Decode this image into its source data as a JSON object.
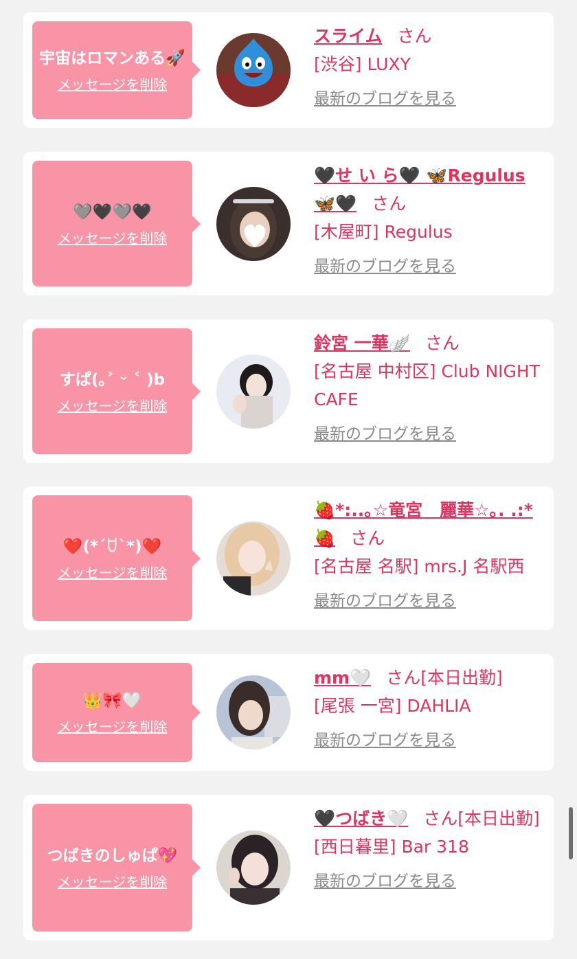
{
  "cards": [
    {
      "message": "宇宙はロマンある🚀",
      "delete_label": "メッセージを削除",
      "name": "スライム",
      "san": "さん",
      "shop": "[渋谷] LUXY",
      "blog_label": "最新のブログを見る"
    },
    {
      "message": "🩶🖤🩶🖤",
      "delete_label": "メッセージを削除",
      "name": "🖤せ い ら🖤 🦋Regulus🦋🖤",
      "san": "さん",
      "shop": "[木屋町] Regulus",
      "blog_label": "最新のブログを見る"
    },
    {
      "message": "すぱ(｡˃ ᵕ ˂ )b",
      "delete_label": "メッセージを削除",
      "name": "鈴宮 一華🪽",
      "san": "さん",
      "shop": "[名古屋 中村区] Club NIGHT CAFE",
      "blog_label": "最新のブログを見る"
    },
    {
      "message": "❤️(*´ꇴ`*)❤️",
      "delete_label": "メッセージを削除",
      "name": "🍓*:..｡☆竜宮　麗華☆｡. .:*🍓",
      "san": "さん",
      "shop": "[名古屋 名駅] mrs.J 名駅西",
      "blog_label": "最新のブログを見る"
    },
    {
      "message": "👑🎀🤍",
      "delete_label": "メッセージを削除",
      "name": "mm🤍",
      "san": "さん[本日出勤]",
      "shop": "[尾張 一宮] DAHLIA",
      "blog_label": "最新のブログを見る"
    },
    {
      "message": "つばきのしゅぱ💖",
      "delete_label": "メッセージを削除",
      "name": "🖤つばき🤍",
      "san": "さん[本日出勤]",
      "shop": "[西日暮里] Bar 318",
      "blog_label": "最新のブログを見る"
    }
  ],
  "colors": {
    "accent": "#e0345f",
    "bubble": "#f994a6",
    "background": "#f2f2f2",
    "link_gray": "#8a8a8a"
  }
}
